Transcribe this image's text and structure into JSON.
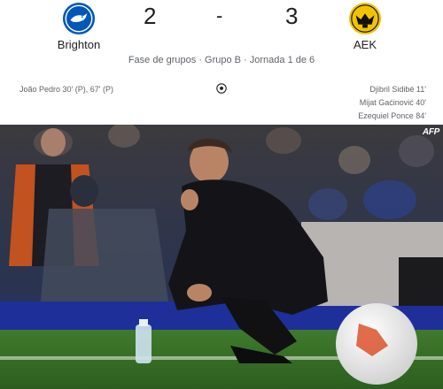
{
  "match": {
    "home": {
      "name": "Brighton",
      "score": "2",
      "crest": "brighton-crest-icon",
      "color": "#0057b8"
    },
    "away": {
      "name": "AEK",
      "score": "3",
      "crest": "aek-crest-icon",
      "color": "#f2c200"
    },
    "separator": "-",
    "competition": "Fase de grupos · Grupo B · Jornada 1 de 6"
  },
  "scorers": {
    "home": [
      "João Pedro 30' (P), 67' (P)"
    ],
    "away": [
      "Djibril Sidibé 11'",
      "Mijat Gaćinović 40'",
      "Ezequiel Ponce 84'"
    ],
    "icon": "soccer-ball-icon"
  },
  "photo": {
    "credit": "AFP",
    "subject": "coach-crouching-pitchside"
  }
}
